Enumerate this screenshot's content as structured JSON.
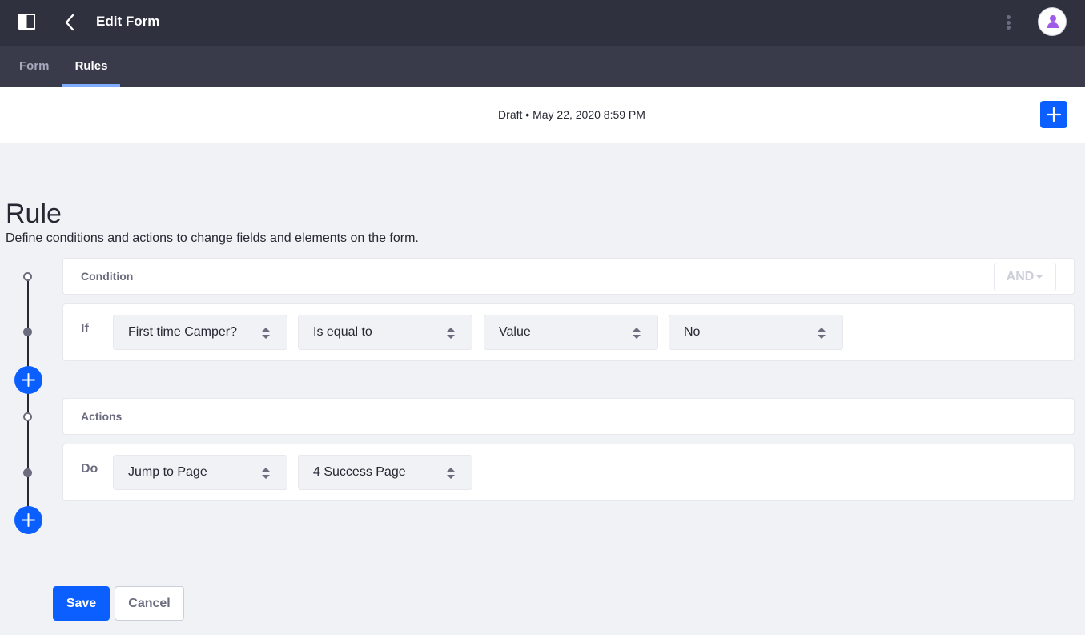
{
  "header": {
    "title": "Edit Form",
    "icons": {
      "sidebar": "sidebar-toggle-icon",
      "back": "chevron-left-icon",
      "menu": "kebab-menu-icon",
      "user": "user-avatar-icon"
    }
  },
  "tabs": [
    {
      "label": "Form",
      "active": false
    },
    {
      "label": "Rules",
      "active": true
    }
  ],
  "status": {
    "text": "Draft • May 22, 2020 8:59 PM",
    "add_icon": "plus-icon"
  },
  "rule": {
    "title": "Rule",
    "description": "Define conditions and actions to change fields and elements on the form.",
    "condition": {
      "header": "Condition",
      "operator": "AND",
      "row_label": "If",
      "selects": [
        "First time Camper?",
        "Is equal to",
        "Value",
        "No"
      ]
    },
    "actions": {
      "header": "Actions",
      "row_label": "Do",
      "selects": [
        "Jump to Page",
        "4 Success Page"
      ]
    }
  },
  "footer": {
    "save_label": "Save",
    "cancel_label": "Cancel"
  },
  "colors": {
    "primary": "#0b5fff",
    "topbar": "#30313f",
    "tabbar": "#393a4a",
    "tab_indicator": "#80acff",
    "background": "#f1f2f5"
  }
}
